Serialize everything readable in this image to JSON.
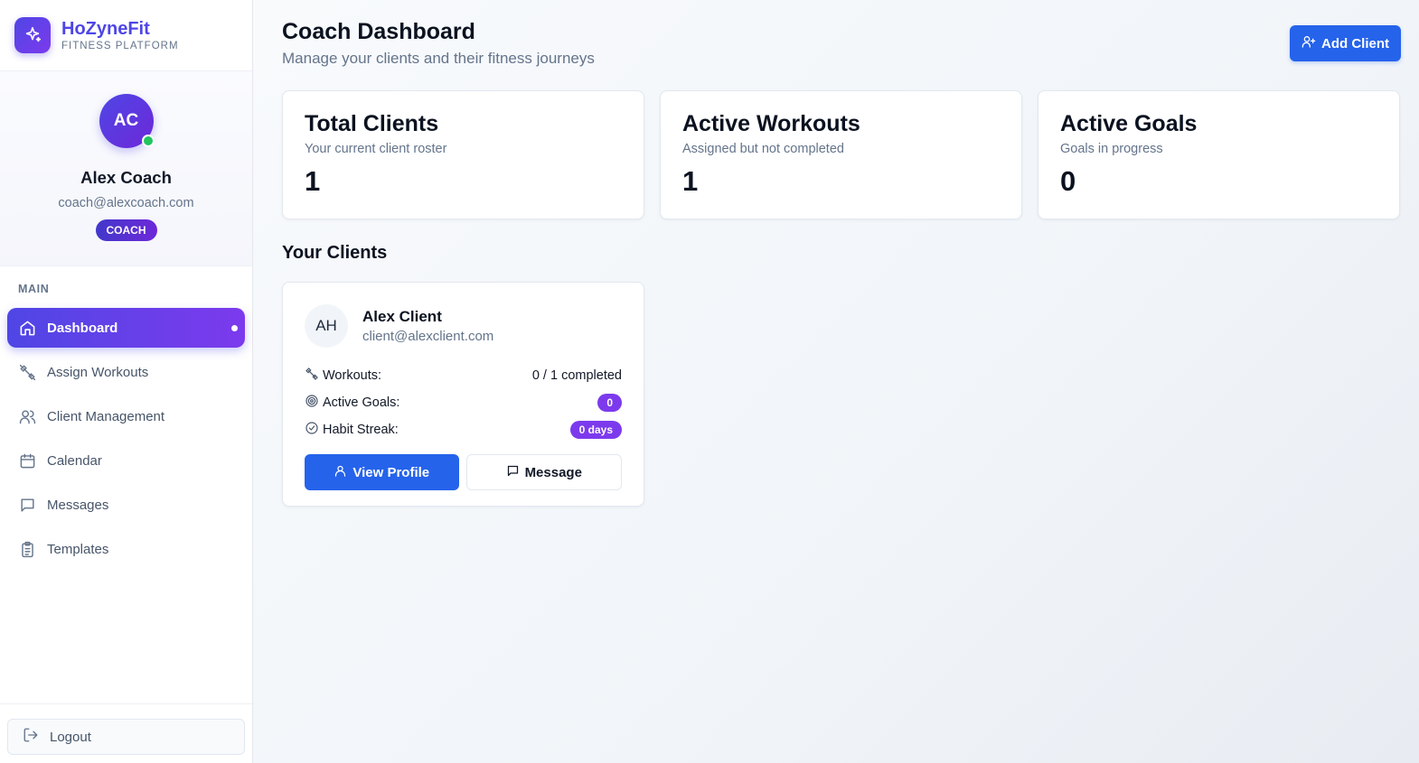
{
  "brand": {
    "name": "HoZyneFit",
    "subtitle": "FITNESS PLATFORM",
    "logo_icon": "sparkles-icon",
    "color": "#4f46e5"
  },
  "profile": {
    "initials": "AC",
    "name": "Alex Coach",
    "email": "coach@alexcoach.com",
    "role": "COACH",
    "status": "online"
  },
  "nav": {
    "section": "MAIN",
    "items": [
      {
        "label": "Dashboard",
        "icon": "home-icon",
        "active": true
      },
      {
        "label": "Assign Workouts",
        "icon": "dumbbell-icon",
        "active": false
      },
      {
        "label": "Client Management",
        "icon": "users-icon",
        "active": false
      },
      {
        "label": "Calendar",
        "icon": "calendar-icon",
        "active": false
      },
      {
        "label": "Messages",
        "icon": "message-icon",
        "active": false
      },
      {
        "label": "Templates",
        "icon": "clipboard-icon",
        "active": false
      }
    ],
    "logout_label": "Logout"
  },
  "header": {
    "title": "Coach Dashboard",
    "subtitle": "Manage your clients and their fitness journeys",
    "add_client_label": "Add Client"
  },
  "stats": [
    {
      "title": "Total Clients",
      "description": "Your current client roster",
      "value": "1"
    },
    {
      "title": "Active Workouts",
      "description": "Assigned but not completed",
      "value": "1"
    },
    {
      "title": "Active Goals",
      "description": "Goals in progress",
      "value": "0"
    }
  ],
  "clients_section": {
    "title": "Your Clients",
    "clients": [
      {
        "initials": "AH",
        "name": "Alex Client",
        "email": "client@alexclient.com",
        "workouts_label": "Workouts:",
        "workouts_value": "0 / 1 completed",
        "goals_label": "Active Goals:",
        "goals_value": "0",
        "streak_label": "Habit Streak:",
        "streak_value": "0 days",
        "view_profile_label": "View Profile",
        "message_label": "Message"
      }
    ]
  },
  "colors": {
    "primary": "#2563eb",
    "accent": "#7c3aed",
    "online": "#22c55e"
  }
}
